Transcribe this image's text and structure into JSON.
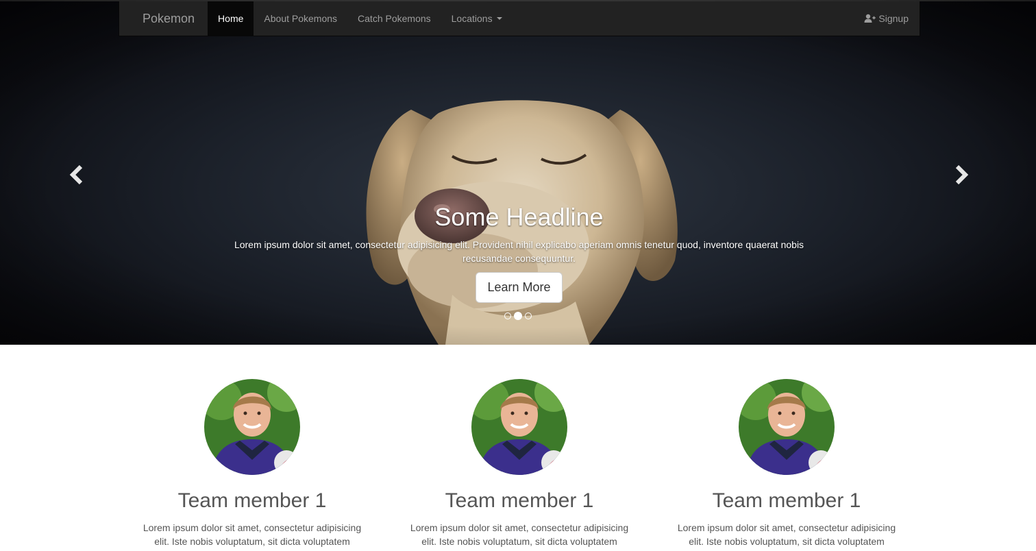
{
  "navbar": {
    "brand": "Pokemon",
    "items": [
      {
        "label": "Home",
        "active": true
      },
      {
        "label": "About Pokemons",
        "active": false
      },
      {
        "label": "Catch Pokemons",
        "active": false
      },
      {
        "label": "Locations",
        "active": false,
        "dropdown": true
      }
    ],
    "signup": {
      "label": "Signup",
      "icon": "user-plus-icon"
    }
  },
  "carousel": {
    "headline": "Some Headline",
    "text": "Lorem ipsum dolor sit amet, consectetur adipisicing elit. Provident nihil explicabo aperiam omnis tenetur quod, inventore quaerat nobis recusandae consequuntur.",
    "button": "Learn More",
    "slides_total": 3,
    "active_slide": 2,
    "prev_icon": "chevron-left-icon",
    "next_icon": "chevron-right-icon"
  },
  "team": [
    {
      "name": "Team member 1",
      "bio": "Lorem ipsum dolor sit amet, consectetur adipisicing elit. Iste nobis voluptatum, sit dicta voluptatem distinctio molestiae, harum dolor, sunt, porro dolorum?"
    },
    {
      "name": "Team member 1",
      "bio": "Lorem ipsum dolor sit amet, consectetur adipisicing elit. Iste nobis voluptatum, sit dicta voluptatem distinctio molestiae, harum dolor, sunt, porro dolorum?"
    },
    {
      "name": "Team member 1",
      "bio": "Lorem ipsum dolor sit amet, consectetur adipisicing elit. Iste nobis voluptatum, sit dicta voluptatem distinctio molestiae, harum dolor, sunt, porro dolorum?"
    }
  ],
  "colors": {
    "navbar_bg": "#222222",
    "navbar_active": "#080808",
    "nav_text": "#9d9d9d",
    "body_text": "#555555"
  }
}
